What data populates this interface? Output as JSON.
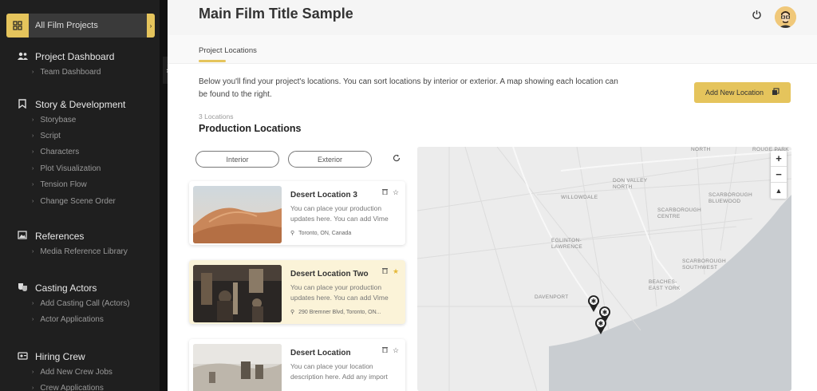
{
  "sidebar": {
    "all_projects": "All Film Projects",
    "sections": [
      {
        "title": "Project Dashboard",
        "icon": "people-icon",
        "items": [
          "Team Dashboard"
        ]
      },
      {
        "title": "Story & Development",
        "icon": "bookmark-icon",
        "items": [
          "Storybase",
          "Script",
          "Characters",
          "Plot Visualization",
          "Tension Flow",
          "Change Scene Order"
        ]
      },
      {
        "title": "References",
        "icon": "image-icon",
        "items": [
          "Media Reference Library"
        ]
      },
      {
        "title": "Casting Actors",
        "icon": "masks-icon",
        "items": [
          "Add Casting Call (Actors)",
          "Actor Applications"
        ]
      },
      {
        "title": "Hiring Crew",
        "icon": "crew-icon",
        "items": [
          "Add New Crew Jobs",
          "Crew Applications"
        ]
      }
    ]
  },
  "header": {
    "title": "Main Film Title Sample"
  },
  "tabs": [
    {
      "label": "Project Locations"
    }
  ],
  "main": {
    "intro": "Below you'll find your project's locations. You can sort locations by interior or exterior. A map showing each location can be found to the right.",
    "add_button": "Add New Location",
    "count": "3 Locations",
    "section_title": "Production Locations",
    "filters": [
      "Interior",
      "Exterior"
    ]
  },
  "locations": [
    {
      "title": "Desert Location 3",
      "desc": "You can place your production updates here. You can add Vime",
      "address": "Toronto, ON, Canada",
      "starred": false
    },
    {
      "title": "Desert Location Two",
      "desc": "You can place your production updates here. You can add Vime",
      "address": "290 Bremner Blvd, Toronto, ON...",
      "starred": true
    },
    {
      "title": "Desert Location",
      "desc": "You can place your location description here. Add any import",
      "address": "",
      "starred": false
    }
  ],
  "map": {
    "labels": [
      "NORTH",
      "ROUGE PARK",
      "DON VALLEY\nNORTH",
      "WILLOWDALE",
      "SCARBOROUGH\nBLUEWOOD",
      "SCARBOROUGH\nCENTRE",
      "EGLINTON-\nLAWRENCE",
      "SCARBOROUGH\nSOUTHWEST",
      "BEACHES-\nEAST YORK",
      "DAVENPORT"
    ],
    "zoom_in": "+",
    "zoom_out": "−",
    "compass": "▲"
  },
  "colors": {
    "accent": "#e5c45c",
    "sidebar": "#1f1f1f",
    "water": "#c9cdd1",
    "land": "#ececec"
  }
}
